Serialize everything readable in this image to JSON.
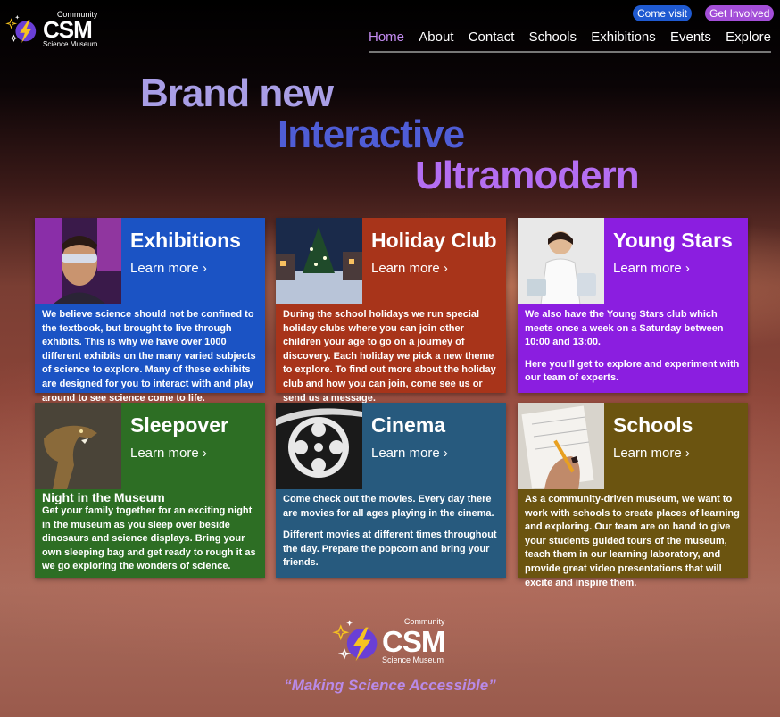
{
  "brand": {
    "community": "Community",
    "name": "CSM",
    "subtitle": "Science Museum"
  },
  "header": {
    "come_visit": "Come visit",
    "get_involved": "Get Involved",
    "nav": [
      "Home",
      "About",
      "Contact",
      "Schools",
      "Exhibitions",
      "Events",
      "Explore"
    ],
    "active_nav": "Home"
  },
  "hero": {
    "line1": "Brand new",
    "line2": "Interactive",
    "line3": "Ultramodern"
  },
  "cards": [
    {
      "title": "Exhibitions",
      "link": "Learn more ›",
      "paragraphs": [
        "We believe science should not be confined to the textbook, but brought to live through exhibits. This is why we have over 1000 different exhibits on the many varied subjects of science to explore. Many of these exhibits are designed for you to interact with and play around to see science come to life."
      ]
    },
    {
      "title": "Holiday Club",
      "link": "Learn more ›",
      "paragraphs": [
        "During the school holidays we run special holiday clubs where you can join other children your age to go on a journey of discovery. Each holiday we pick a new theme to explore. To find out more about the holiday club and how you can join, come see us or send us a message."
      ]
    },
    {
      "title": "Young Stars",
      "link": "Learn more ›",
      "paragraphs": [
        "We also have the Young Stars club which meets once a week on a Saturday between 10:00 and 13:00.",
        "Here you'll get to explore and experiment with our team of experts."
      ]
    },
    {
      "title": "Sleepover",
      "link": "Learn more ›",
      "subheading": "Night in the Museum",
      "paragraphs": [
        "Get your family together for an exciting night in the museum as you sleep over beside dinosaurs and science displays. Bring your own sleeping bag and get ready to rough it as we go exploring the wonders of science."
      ]
    },
    {
      "title": "Cinema",
      "link": "Learn more ›",
      "paragraphs": [
        "Come check out the movies. Every day there are movies for all ages playing in the cinema.",
        "Different movies at different times throughout the day. Prepare the popcorn and bring your friends."
      ]
    },
    {
      "title": "Schools",
      "link": "Learn more ›",
      "paragraphs": [
        "As a community-driven museum, we want to work with schools to create places of learning and exploring. Our team are on hand to give your students guided tours of the museum, teach them in our learning laboratory, and provide great video presentations that will excite and inspire them."
      ]
    }
  ],
  "footer": {
    "tagline": "“Making Science Accessible”"
  },
  "colors": {
    "exhibitions": "#1b53c4",
    "holiday": "#a8341a",
    "young_stars": "#8b1ee0",
    "sleepover": "#2d6e24",
    "cinema": "#275a7e",
    "schools": "#6b5410",
    "nav_active": "#c48cf2"
  },
  "icons": [
    "lightning-logo-icon",
    "sparkle-icon",
    "chevron-right-icon"
  ]
}
